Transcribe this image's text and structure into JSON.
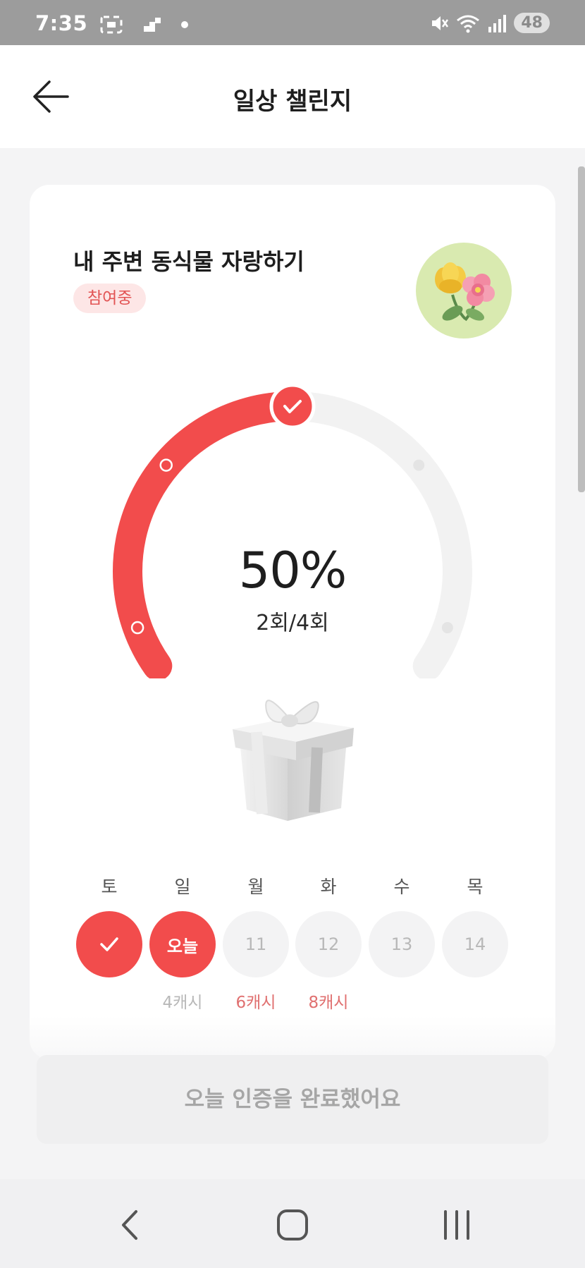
{
  "status_bar": {
    "time": "7:35",
    "battery": "48",
    "icons": [
      "scan-icon",
      "signal-steps-icon",
      "dot-icon",
      "mute-icon",
      "wifi-icon",
      "cell-signal-icon"
    ]
  },
  "header": {
    "title": "일상 챌린지",
    "back_icon": "arrow-left-icon"
  },
  "challenge": {
    "title": "내 주변 동식물 자랑하기",
    "badge": "참여중",
    "image": "flower-icon",
    "progress_percent": 50,
    "percent_label": "50%",
    "count_label": "2회/4회",
    "completed": 2,
    "total": 4,
    "reward_image": "gift-box-icon"
  },
  "week": [
    {
      "day": "토",
      "state": "done",
      "label": "",
      "reward": ""
    },
    {
      "day": "일",
      "state": "today",
      "label": "오늘",
      "reward": "4캐시"
    },
    {
      "day": "월",
      "state": "future",
      "label": "11",
      "reward": "6캐시"
    },
    {
      "day": "화",
      "state": "future",
      "label": "12",
      "reward": "8캐시"
    },
    {
      "day": "수",
      "state": "future",
      "label": "13",
      "reward": ""
    },
    {
      "day": "목",
      "state": "future",
      "label": "14",
      "reward": ""
    }
  ],
  "action": {
    "label": "오늘 인증을 완료했어요"
  },
  "colors": {
    "accent": "#f24c4c",
    "track": "#f2f2f2",
    "badge_bg": "#fde6e6"
  },
  "nav": {
    "icons": [
      "back-nav-icon",
      "home-nav-icon",
      "recents-nav-icon"
    ]
  }
}
